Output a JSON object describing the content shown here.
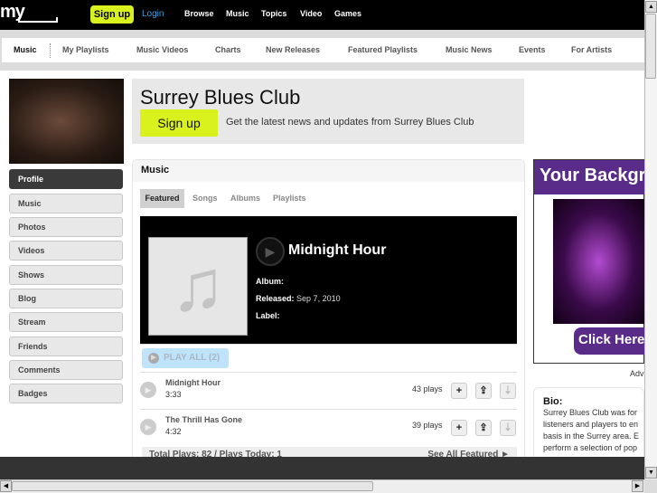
{
  "topbar": {
    "logo": "my",
    "signup": "Sign up",
    "login": "Login",
    "nav": [
      "Browse",
      "Music",
      "Topics",
      "Video",
      "Games"
    ]
  },
  "subnav": [
    "Music",
    "My Playlists",
    "Music Videos",
    "Charts",
    "New Releases",
    "Featured Playlists",
    "Music News",
    "Events",
    "For Artists"
  ],
  "banner": {
    "title": "Surrey Blues Club",
    "signup": "Sign up",
    "subtitle": "Get the latest news and updates from Surrey Blues Club"
  },
  "sidebar": [
    "Profile",
    "Music",
    "Photos",
    "Videos",
    "Shows",
    "Blog",
    "Stream",
    "Friends",
    "Comments",
    "Badges"
  ],
  "music": {
    "title": "Music",
    "tabs": [
      "Featured",
      "Songs",
      "Albums",
      "Playlists"
    ],
    "featured": {
      "label": "",
      "name": "Midnight Hour",
      "album_label": "Album:",
      "album": "",
      "released_label": "Released:",
      "released": "Sep 7, 2010",
      "label_label": "Label:"
    },
    "play_all": "PLAY ALL (2)",
    "songs": [
      {
        "name": "Midnight Hour",
        "duration": "3:33",
        "plays": "43 plays"
      },
      {
        "name": "The Thrill Has Gone",
        "duration": "4:32",
        "plays": "39 plays"
      }
    ],
    "footer_left": "Total Plays: 82 / Plays Today: 1",
    "footer_right": "See All Featured ►"
  },
  "ad": {
    "headline": "Your Backgr",
    "button": "Click Here",
    "caption": "Adv"
  },
  "bio": {
    "title": "Bio:",
    "lines": [
      "Surrey Blues Club was for",
      "listeners and players to en",
      "basis in the Surrey area. E",
      "perform a selection of pop"
    ]
  },
  "colors": {
    "accent": "#d9f21d",
    "featured_label": "#d08a1a",
    "ad_purple": "#5a2c8a"
  }
}
